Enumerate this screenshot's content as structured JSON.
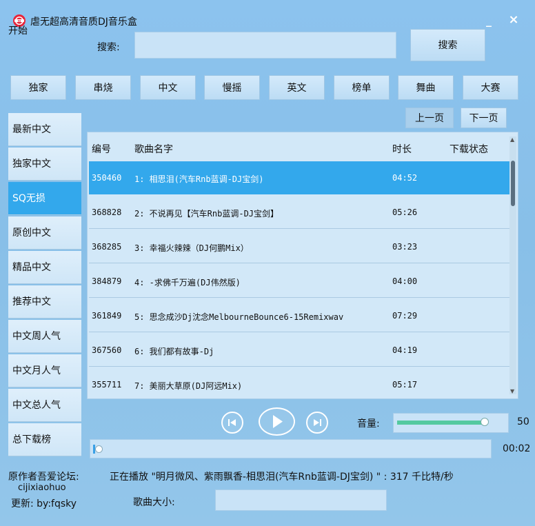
{
  "window": {
    "title": "虐无超高清音质DJ音乐盒",
    "start_label": "开始",
    "min_label": "_",
    "close_label": "×"
  },
  "search": {
    "label": "搜索:",
    "value": "",
    "button_label": "搜索"
  },
  "categories": [
    "独家",
    "串烧",
    "中文",
    "慢摇",
    "英文",
    "榜单",
    "舞曲",
    "大赛"
  ],
  "sidebar": {
    "items": [
      "最新中文",
      "独家中文",
      "SQ无损",
      "原创中文",
      "精品中文",
      "推荐中文",
      "中文周人气",
      "中文月人气",
      "中文总人气",
      "总下载榜"
    ],
    "selected_index": 2
  },
  "pager": {
    "prev_label": "上一页",
    "next_label": "下一页"
  },
  "table": {
    "headers": [
      "编号",
      "歌曲名字",
      "时长",
      "下载状态"
    ],
    "rows": [
      {
        "id": "350460",
        "name": "1: 相思泪(汽车Rnb蓝调-DJ宝剑)",
        "duration": "04:52",
        "status": ""
      },
      {
        "id": "368828",
        "name": "2: 不说再见【汽车Rnb蓝调-DJ宝剑】",
        "duration": "05:26",
        "status": ""
      },
      {
        "id": "368285",
        "name": "3: 幸福火辣辣（DJ何鹏Mix）",
        "duration": "03:23",
        "status": ""
      },
      {
        "id": "384879",
        "name": "4: -求佛千万遍(DJ伟然版)",
        "duration": "04:00",
        "status": ""
      },
      {
        "id": "361849",
        "name": "5: 思念成沙Dj沈念MelbourneBounce6-15Remixwav",
        "duration": "07:29",
        "status": ""
      },
      {
        "id": "367560",
        "name": "6: 我们都有故事-Dj",
        "duration": "04:19",
        "status": ""
      },
      {
        "id": "355711",
        "name": "7: 美丽大草原(DJ阿远Mix)",
        "duration": "05:17",
        "status": ""
      }
    ],
    "selected_index": 0
  },
  "player": {
    "volume_label": "音量:",
    "volume_value": "50",
    "volume_fraction": 0.5,
    "time": "00:02",
    "progress_fraction": 0.01
  },
  "footer": {
    "author_label": "原作者吾爱论坛:",
    "author_name": "cijixiaohuo",
    "updater": "更新: by:fqsky",
    "now_playing": "正在播放 \"明月微风、紫雨飘香-相思泪(汽车Rnb蓝调-DJ宝剑) \" : 317 千比特/秒",
    "size_label": "歌曲大小:",
    "size_value": ""
  },
  "colors": {
    "background": "#8cc3ee",
    "accent": "#33a8ec",
    "volume_fill": "#54c9a0"
  }
}
